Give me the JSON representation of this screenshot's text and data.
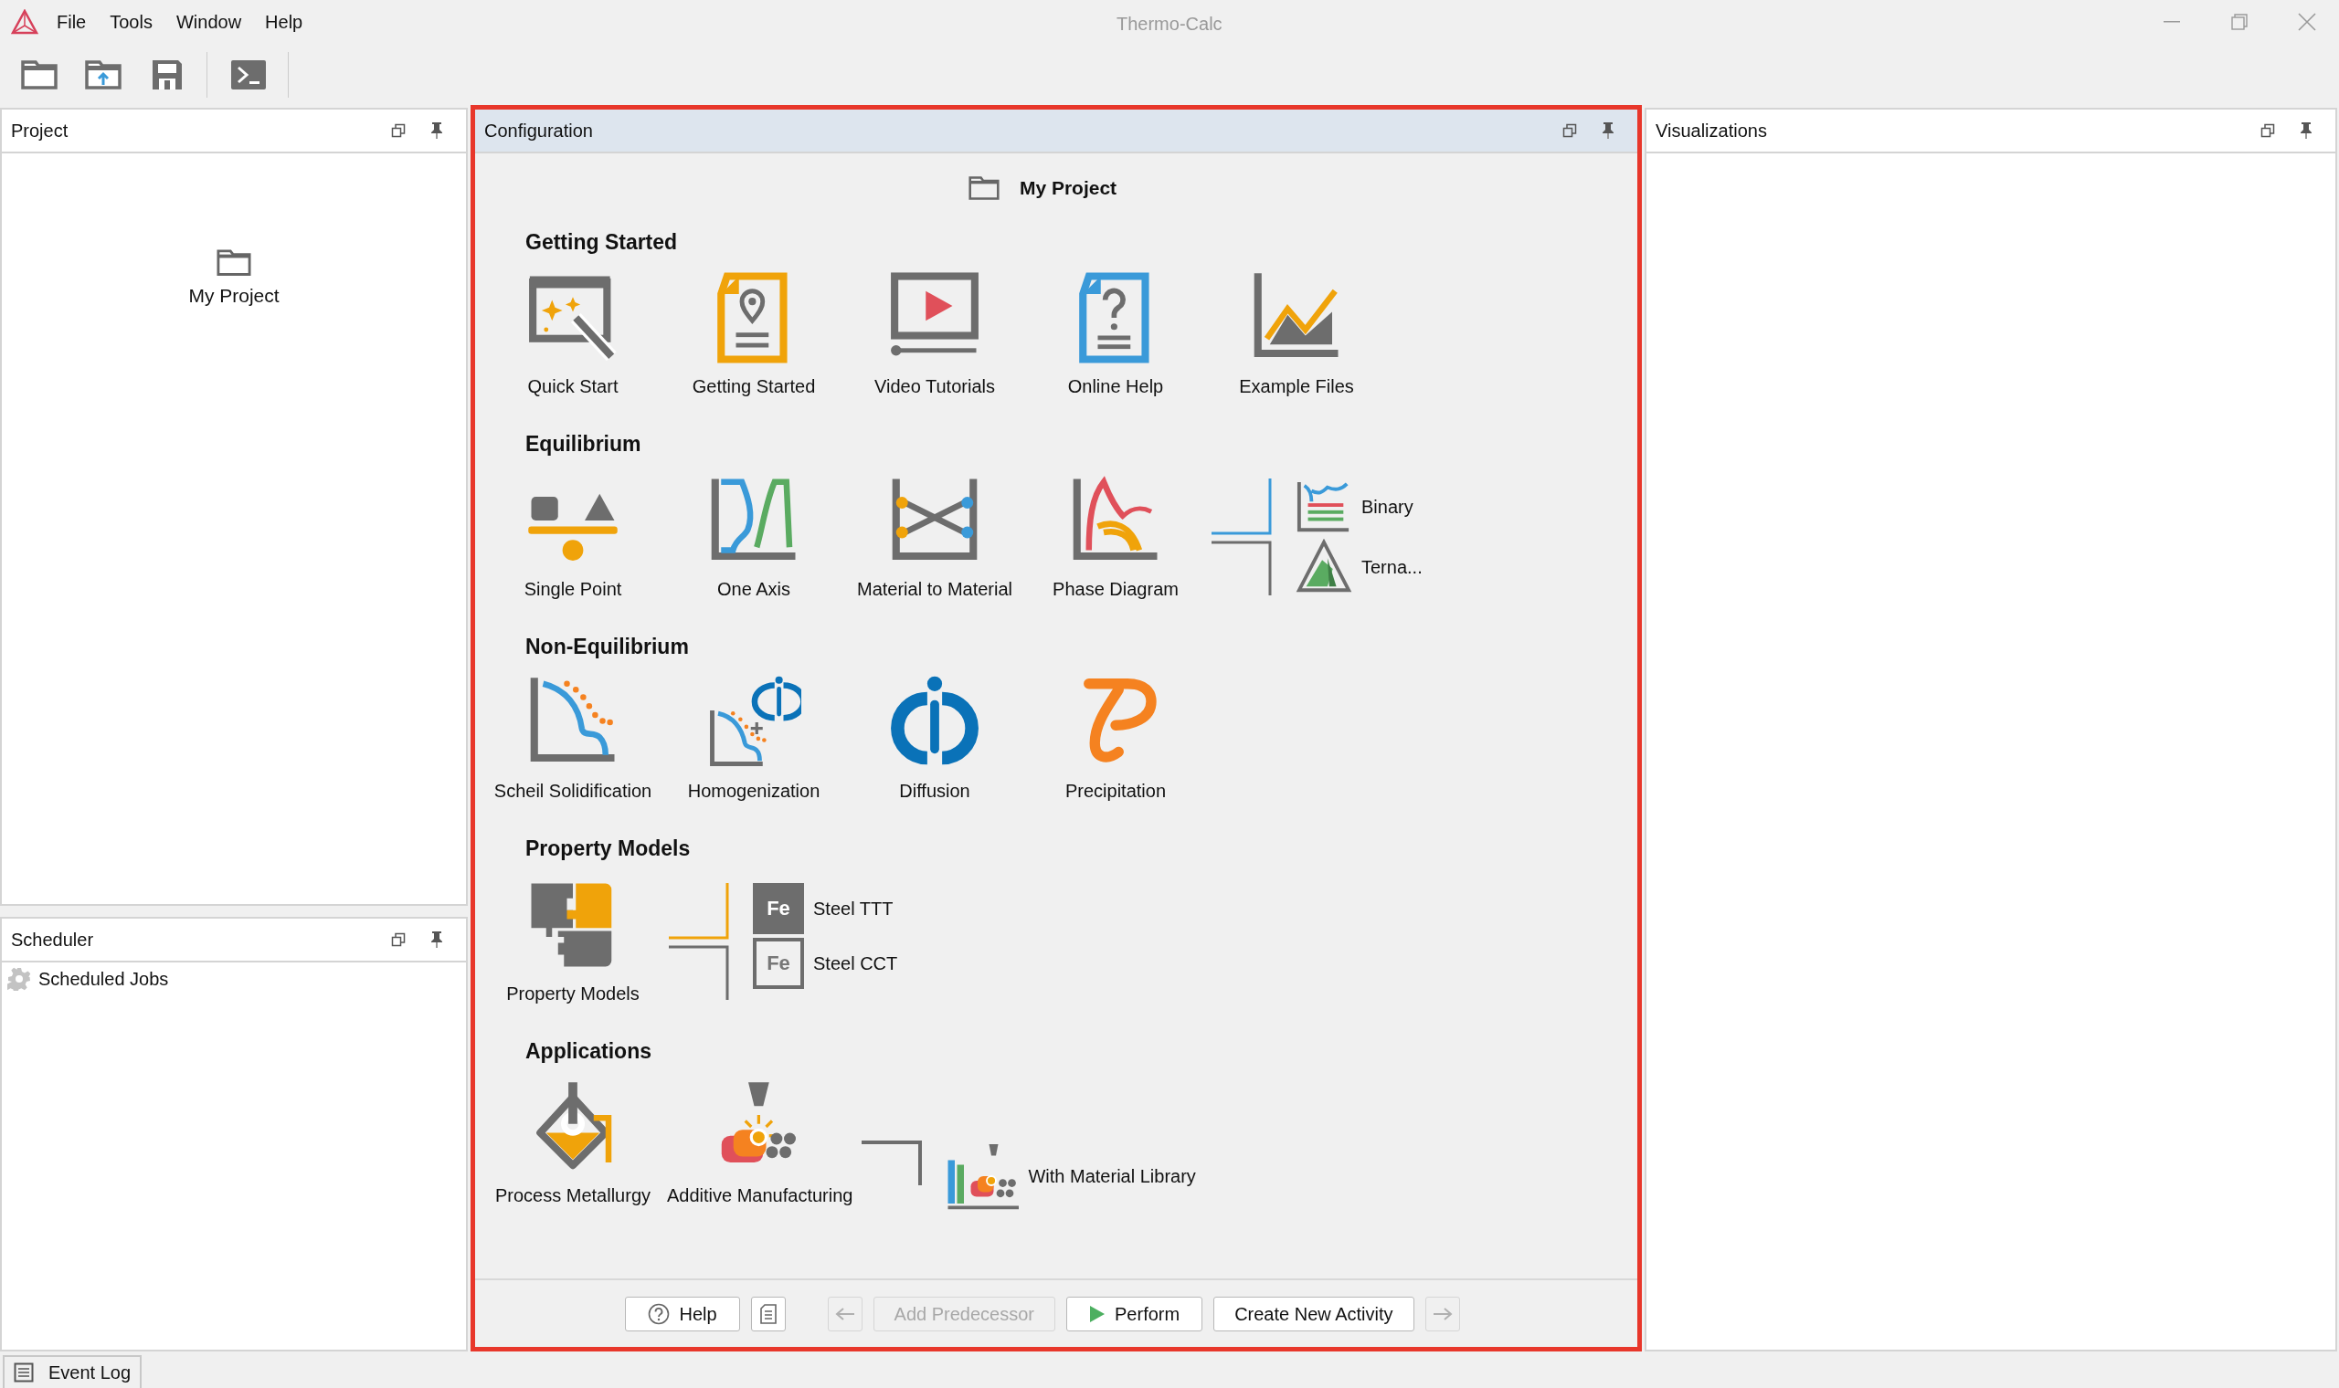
{
  "window": {
    "title": "Thermo-Calc",
    "menu": [
      "File",
      "Tools",
      "Window",
      "Help"
    ]
  },
  "project_panel": {
    "title": "Project",
    "project_name": "My Project"
  },
  "scheduler_panel": {
    "title": "Scheduler",
    "items": [
      "Scheduled Jobs"
    ]
  },
  "configuration": {
    "title": "Configuration",
    "project_name": "My Project",
    "sections": [
      {
        "title": "Getting Started",
        "items": [
          {
            "kind": "tile",
            "label": "Quick Start"
          },
          {
            "kind": "tile",
            "label": "Getting Started"
          },
          {
            "kind": "tile",
            "label": "Video Tutorials"
          },
          {
            "kind": "tile",
            "label": "Online Help"
          },
          {
            "kind": "tile",
            "label": "Example Files"
          }
        ]
      },
      {
        "title": "Equilibrium",
        "items": [
          {
            "kind": "tile",
            "label": "Single Point"
          },
          {
            "kind": "tile",
            "label": "One Axis"
          },
          {
            "kind": "tile",
            "label": "Material to Material"
          },
          {
            "kind": "tile",
            "label": "Phase Diagram"
          },
          {
            "kind": "branch",
            "options": [
              {
                "label": "Binary"
              },
              {
                "label": "Terna..."
              }
            ]
          }
        ]
      },
      {
        "title": "Non-Equilibrium",
        "items": [
          {
            "kind": "tile",
            "label": "Scheil Solidification"
          },
          {
            "kind": "tile",
            "label": "Homogenization"
          },
          {
            "kind": "tile",
            "label": "Diffusion"
          },
          {
            "kind": "tile",
            "label": "Precipitation"
          }
        ]
      },
      {
        "title": "Property Models",
        "items": [
          {
            "kind": "tile",
            "label": "Property Models"
          },
          {
            "kind": "branch",
            "options": [
              {
                "symbol": "Fe",
                "label": "Steel TTT"
              },
              {
                "symbol": "Fe",
                "label": "Steel CCT"
              }
            ]
          }
        ]
      },
      {
        "title": "Applications",
        "items": [
          {
            "kind": "tile",
            "label": "Process Metallurgy"
          },
          {
            "kind": "tile",
            "label": "Additive Manufacturing"
          },
          {
            "kind": "branch",
            "options": [
              {
                "label": "With Material Library"
              }
            ]
          }
        ]
      }
    ],
    "buttons": [
      {
        "kind": "help",
        "label": "Help",
        "disabled": false
      },
      {
        "kind": "notes",
        "disabled": false
      },
      {
        "kind": "back",
        "disabled": true
      },
      {
        "kind": "text",
        "label": "Add Predecessor",
        "disabled": true
      },
      {
        "kind": "perform",
        "label": "Perform",
        "disabled": false
      },
      {
        "kind": "text",
        "label": "Create New Activity",
        "disabled": false
      },
      {
        "kind": "forward",
        "disabled": true
      }
    ]
  },
  "visualizations_panel": {
    "title": "Visualizations"
  },
  "bottom_tabs": [
    {
      "label": "Event Log"
    }
  ]
}
